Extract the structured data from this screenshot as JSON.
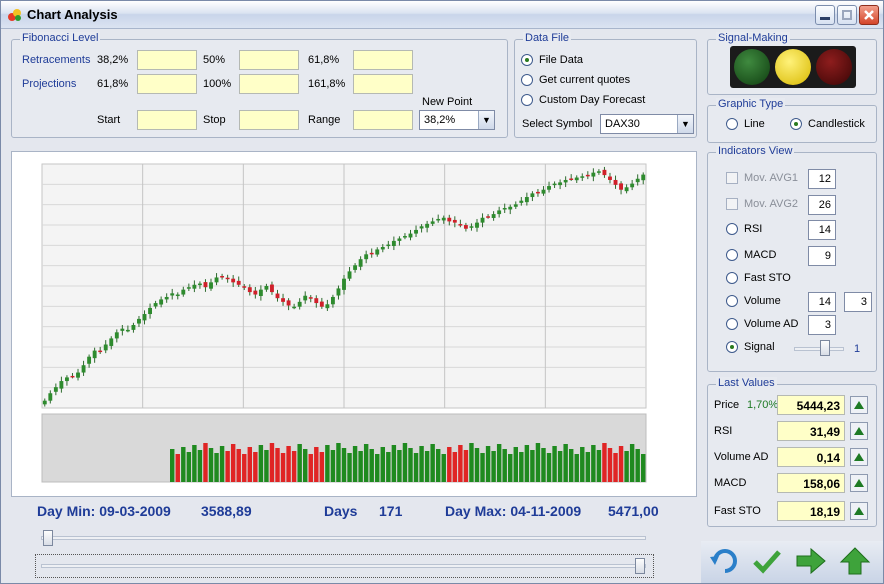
{
  "window": {
    "title": "Chart Analysis",
    "min_icon": "minimize-icon",
    "max_icon": "maximize-icon",
    "close_icon": "close-icon"
  },
  "fibonacci": {
    "legend": "Fibonacci Level",
    "retracements_label": "Retracements",
    "retracements": [
      "38,2%",
      "50%",
      "61,8%"
    ],
    "projections_label": "Projections",
    "projections": [
      "61,8%",
      "100%",
      "161,8%"
    ],
    "start_label": "Start",
    "stop_label": "Stop",
    "range_label": "Range",
    "new_point_label": "New Point",
    "new_point_value": "38,2%"
  },
  "data_file": {
    "legend": "Data File",
    "options": [
      "File Data",
      "Get current quotes",
      "Custom Day Forecast"
    ],
    "selected": "File Data",
    "symbol_label": "Select Symbol",
    "symbol_value": "DAX30"
  },
  "signal_making": {
    "legend": "Signal-Making",
    "lamps": [
      "green",
      "yellow",
      "red"
    ],
    "active": "yellow"
  },
  "graphic_type": {
    "legend": "Graphic Type",
    "options": [
      "Line",
      "Candlestick"
    ],
    "selected": "Candlestick"
  },
  "indicators": {
    "legend": "Indicators View",
    "items": [
      {
        "label": "Mov. AVG1",
        "kind": "check",
        "value": "12"
      },
      {
        "label": "Mov. AVG2",
        "kind": "check",
        "value": "26"
      },
      {
        "label": "RSI",
        "kind": "radio",
        "value": "14"
      },
      {
        "label": "MACD",
        "kind": "radio",
        "value": "9"
      },
      {
        "label": "Fast STO",
        "kind": "radio",
        "value": ""
      },
      {
        "label": "Volume",
        "kind": "radio",
        "value": "14",
        "value2": "3"
      },
      {
        "label": "Volume AD",
        "kind": "radio",
        "value": "3"
      },
      {
        "label": "Signal",
        "kind": "radio",
        "selected": true,
        "slider_value": "1"
      }
    ]
  },
  "last_values": {
    "legend": "Last Values",
    "rows": [
      {
        "label": "Price",
        "change": "1,70%",
        "value": "5444,23"
      },
      {
        "label": "RSI",
        "value": "31,49"
      },
      {
        "label": "Volume AD",
        "value": "0,14"
      },
      {
        "label": "MACD",
        "value": "158,06"
      },
      {
        "label": "Fast STO",
        "value": "18,19"
      }
    ]
  },
  "summary": {
    "day_min": "Day Min: 09-03-2009",
    "min_value": "3588,89",
    "days_label": "Days",
    "days_value": "171",
    "day_max": "Day Max: 04-11-2009",
    "max_value": "5471,00"
  },
  "chart_data": {
    "type": "candlestick",
    "grid": true,
    "close": [
      3589,
      3650,
      3700,
      3750,
      3780,
      3790,
      3820,
      3880,
      3950,
      4000,
      3990,
      4050,
      4100,
      4150,
      4180,
      4170,
      4210,
      4260,
      4300,
      4350,
      4390,
      4420,
      4440,
      4470,
      4460,
      4500,
      4520,
      4540,
      4550,
      4520,
      4560,
      4600,
      4610,
      4590,
      4560,
      4540,
      4520,
      4480,
      4460,
      4500,
      4530,
      4480,
      4430,
      4400,
      4370,
      4360,
      4400,
      4450,
      4430,
      4390,
      4360,
      4380,
      4440,
      4510,
      4590,
      4650,
      4700,
      4750,
      4790,
      4800,
      4830,
      4850,
      4870,
      4900,
      4920,
      4940,
      4960,
      4990,
      5020,
      5040,
      5060,
      5080,
      5090,
      5060,
      5050,
      5030,
      5000,
      5020,
      5050,
      5090,
      5100,
      5120,
      5150,
      5170,
      5180,
      5200,
      5230,
      5260,
      5290,
      5300,
      5320,
      5350,
      5370,
      5380,
      5400,
      5410,
      5420,
      5430,
      5440,
      5460,
      5471,
      5440,
      5400,
      5360,
      5320,
      5340,
      5370,
      5410,
      5444
    ],
    "volume_colors": [
      "green",
      "red",
      "yellow"
    ]
  },
  "actions": {
    "undo": "undo-icon",
    "ok": "check-icon",
    "next": "arrow-right-icon",
    "up": "arrow-up-icon"
  }
}
